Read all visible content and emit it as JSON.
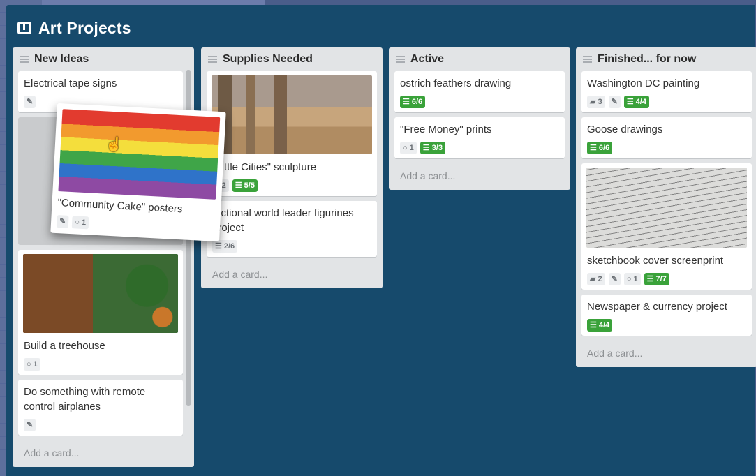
{
  "board": {
    "title": "Art Projects"
  },
  "lists": [
    {
      "title": "New Ideas",
      "cards": [
        {
          "title": "Electrical tape signs"
        },
        {
          "title": "Build a treehouse",
          "comments": "1"
        },
        {
          "title": "Do something with remote control airplanes"
        }
      ],
      "add_card": "Add a card..."
    },
    {
      "title": "Supplies Needed",
      "cards": [
        {
          "title": "\"Little Cities\" sculpture",
          "comments": "2",
          "checklist": "5/5"
        },
        {
          "title": "Fictional world leader figurines project",
          "checklist": "2/6"
        }
      ],
      "add_card": "Add a card..."
    },
    {
      "title": "Active",
      "cards": [
        {
          "title": "ostrich feathers drawing",
          "checklist": "6/6"
        },
        {
          "title": "\"Free Money\" prints",
          "comments": "1",
          "checklist": "3/3"
        }
      ],
      "add_card": "Add a card..."
    },
    {
      "title": "Finished... for now",
      "cards": [
        {
          "title": "Washington DC painting",
          "votes": "3",
          "checklist": "4/4"
        },
        {
          "title": "Goose drawings",
          "checklist": "6/6"
        },
        {
          "title": "sketchbook cover screenprint",
          "votes": "2",
          "comments": "1",
          "checklist": "7/7"
        },
        {
          "title": "Newspaper & currency project",
          "checklist": "4/4"
        }
      ],
      "add_card": "Add a card..."
    }
  ],
  "dragged_card": {
    "title": "\"Community Cake\" posters",
    "comments": "1"
  },
  "colors": {
    "board_bg": "#164a6c",
    "list_bg": "#e2e4e6",
    "checklist_complete": "#3aa23a"
  },
  "icons": [
    "board-icon",
    "list-menu-icon",
    "pencil-icon",
    "comment-icon",
    "checklist-icon",
    "speech-bubble-icon",
    "hand-cursor-icon"
  ]
}
